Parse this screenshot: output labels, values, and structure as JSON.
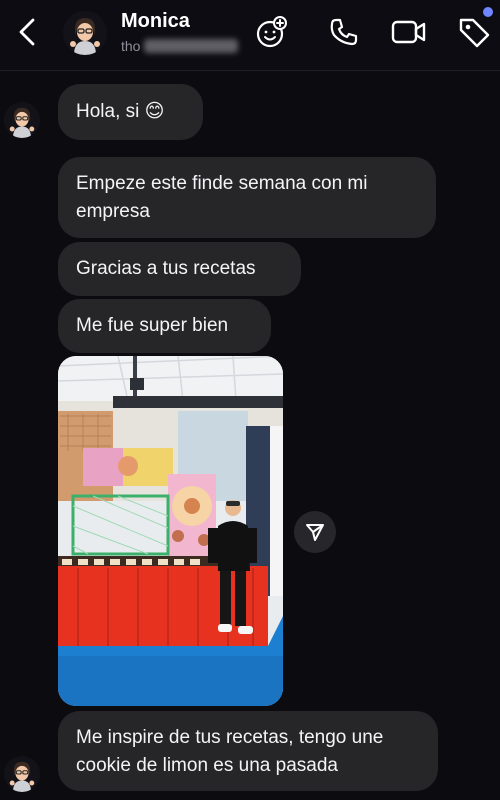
{
  "header": {
    "contact_name": "Monica",
    "contact_handle": "tho",
    "icons": [
      "back-chevron-icon",
      "avatar",
      "sticker-icon",
      "phone-icon",
      "video-icon",
      "tag-icon"
    ]
  },
  "messages": [
    {
      "id": "m1",
      "text": "Hola, si 😊",
      "sender": "contact"
    },
    {
      "id": "m2",
      "text": "Empeze este finde semana con mi empresa",
      "sender": "contact"
    },
    {
      "id": "m3",
      "text": "Gracias a tus recetas",
      "sender": "contact"
    },
    {
      "id": "m4",
      "text": "Me fue super bien",
      "sender": "contact"
    },
    {
      "id": "m5",
      "type": "photo",
      "sender": "contact"
    },
    {
      "id": "m6",
      "text": "Me inspire de tus recetas, tengo une cookie de limon es una pasada",
      "sender": "contact"
    }
  ],
  "colors": {
    "background": "#0b0b10",
    "bubble": "#262629",
    "accent_dot": "#6f86ff"
  }
}
